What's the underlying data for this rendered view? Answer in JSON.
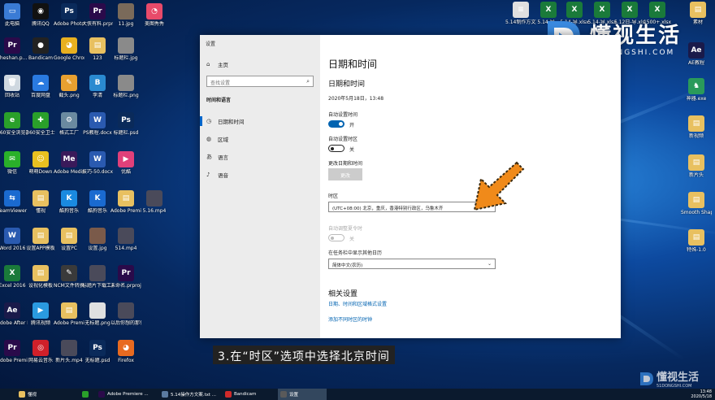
{
  "desktop": {
    "left_icons": [
      {
        "label": "此电脑",
        "color": "#3a7bd5",
        "glyph": "▭"
      },
      {
        "label": "腾讯QQ",
        "color": "#111111",
        "glyph": "◉"
      },
      {
        "label": "Adobe Photosh...",
        "color": "#0a2a5a",
        "glyph": "Ps"
      },
      {
        "label": "大侠有料.prproj",
        "color": "#2a0a4a",
        "glyph": "Pr"
      },
      {
        "label": "11.jpg",
        "color": "#7a6a5a",
        "glyph": ""
      },
      {
        "label": "美图秀秀",
        "color": "#e84a6a",
        "glyph": "◔"
      },
      {
        "label": "zheshan.p...",
        "color": "#2a0a4a",
        "glyph": "Pr"
      },
      {
        "label": "Bandicam",
        "color": "#222222",
        "glyph": "●"
      },
      {
        "label": "Google Chrome",
        "color": "#e8b020",
        "glyph": "◕"
      },
      {
        "label": "123",
        "color": "#e8c060",
        "glyph": "▤"
      },
      {
        "label": "标题栏.jpg",
        "color": "#8a8a8a",
        "glyph": ""
      },
      {
        "label": "回收站",
        "color": "#cfd8e0",
        "glyph": "🗑"
      },
      {
        "label": "百度网盘",
        "color": "#2a7ae0",
        "glyph": "☁"
      },
      {
        "label": "截头.png",
        "color": "#e8a030",
        "glyph": "✎"
      },
      {
        "label": "李清",
        "color": "#2a8ad0",
        "glyph": "B"
      },
      {
        "label": "标题栏.png",
        "color": "#8a8a8a",
        "glyph": ""
      },
      {
        "label": "360安全浏览器",
        "color": "#2aa02a",
        "glyph": "e"
      },
      {
        "label": "360安全卫士",
        "color": "#2aa02a",
        "glyph": "✚"
      },
      {
        "label": "格式工厂",
        "color": "#6a8aa0",
        "glyph": "⚙"
      },
      {
        "label": "PS教程.docx",
        "color": "#2a5ab0",
        "glyph": "W"
      },
      {
        "label": "标题栏.psd",
        "color": "#0a2a5a",
        "glyph": "Ps"
      },
      {
        "label": "微信",
        "color": "#2ab02a",
        "glyph": "✉"
      },
      {
        "label": "萌萌Down",
        "color": "#e8c020",
        "glyph": "☺"
      },
      {
        "label": "Adobe Media...",
        "color": "#3a1a5a",
        "glyph": "Me"
      },
      {
        "label": "技巧-50.docx",
        "color": "#2a5ab0",
        "glyph": "W"
      },
      {
        "label": "优酷",
        "color": "#e0407a",
        "glyph": "▶"
      },
      {
        "label": "TeamViewer",
        "color": "#1a6ad0",
        "glyph": "⇆"
      },
      {
        "label": "懂视",
        "color": "#e8c060",
        "glyph": "▤"
      },
      {
        "label": "酷狗音乐",
        "color": "#1a8ae0",
        "glyph": "K"
      },
      {
        "label": "酷狗音乐",
        "color": "#1a6ad0",
        "glyph": "K"
      },
      {
        "label": "Adobe Premier...",
        "color": "#e8c060",
        "glyph": "▤"
      },
      {
        "label": "5.16.mp4",
        "color": "#4a4a5a",
        "glyph": ""
      },
      {
        "label": "Word 2016",
        "color": "#2a5ab0",
        "glyph": "W"
      },
      {
        "label": "设置APP模板",
        "color": "#e8c060",
        "glyph": "▤"
      },
      {
        "label": "设置PC",
        "color": "#e8c060",
        "glyph": "▤"
      },
      {
        "label": "设置.jpg",
        "color": "#7a5a4a",
        "glyph": ""
      },
      {
        "label": "514.mp4",
        "color": "#4a4a5a",
        "glyph": ""
      },
      {
        "label": "Excel 2016",
        "color": "#1a7a3a",
        "glyph": "X"
      },
      {
        "label": "设视化模板",
        "color": "#e8c060",
        "glyph": "▤"
      },
      {
        "label": "NCM文件转换.exe",
        "color": "#3a3a3a",
        "glyph": "✎"
      },
      {
        "label": "标题片下载工具.mp4",
        "color": "#4a4a5a",
        "glyph": ""
      },
      {
        "label": "未命名.prproj",
        "color": "#2a0a4a",
        "glyph": "Pr"
      },
      {
        "label": "Adobe After Effects 2020",
        "color": "#1a1a4a",
        "glyph": "Ae"
      },
      {
        "label": "腾讯视频",
        "color": "#2a9ae0",
        "glyph": "▶"
      },
      {
        "label": "Adobe Premier...",
        "color": "#e8c060",
        "glyph": "▤"
      },
      {
        "label": "无标题.png",
        "color": "#e0e0e0",
        "glyph": ""
      },
      {
        "label": "以后你想的那件事情.mp4",
        "color": "#4a4a5a",
        "glyph": ""
      },
      {
        "label": "Adobe Premie...",
        "color": "#2a0a4a",
        "glyph": "Pr"
      },
      {
        "label": "网易云音乐",
        "color": "#d0202a",
        "glyph": "◎"
      },
      {
        "label": "新片头.mp4",
        "color": "#4a4a5a",
        "glyph": ""
      },
      {
        "label": "无标题.psd",
        "color": "#0a2a5a",
        "glyph": "Ps"
      },
      {
        "label": "Firefox",
        "color": "#e86a20",
        "glyph": "◕"
      }
    ],
    "top_right_icons": [
      {
        "label": "5.14制作方文案.txt",
        "color": "#e0e0e0",
        "glyph": "≡"
      },
      {
        "label": "5.14-导...",
        "color": "#1a7a3a",
        "glyph": "X"
      },
      {
        "label": "5.14-导.xlsx",
        "color": "#1a7a3a",
        "glyph": "X"
      },
      {
        "label": "5.14-导.xlsx",
        "color": "#1a7a3a",
        "glyph": "X"
      },
      {
        "label": "5.12日-导.xlsx",
        "color": "#1a7a3a",
        "glyph": "X"
      },
      {
        "label": "1500+.xlsx",
        "color": "#1a7a3a",
        "glyph": "X"
      },
      {
        "label": "素材",
        "color": "#e8c060",
        "glyph": "▤"
      }
    ],
    "right_icons": [
      {
        "label": "AE教程",
        "color": "#1a1a4a",
        "glyph": "Ae"
      },
      {
        "label": "神器.exe",
        "color": "#2a9a5a",
        "glyph": "♞"
      },
      {
        "label": "新视频",
        "color": "#e8c060",
        "glyph": "▤"
      },
      {
        "label": "新片头",
        "color": "#e8c060",
        "glyph": "▤"
      },
      {
        "label": "Smooth Shapes...",
        "color": "#e8c060",
        "glyph": "▤"
      },
      {
        "label": "特殊-1.0",
        "color": "#e8c060",
        "glyph": "▤"
      }
    ]
  },
  "window": {
    "title": "设置",
    "sidebar": {
      "home": "主页",
      "search_placeholder": "查找设置",
      "section": "时间和语言",
      "items": [
        {
          "label": "日期和时间",
          "icon": "clock-icon",
          "glyph": "◷"
        },
        {
          "label": "区域",
          "icon": "globe-icon",
          "glyph": "◍"
        },
        {
          "label": "语言",
          "icon": "language-icon",
          "glyph": "あ"
        },
        {
          "label": "语音",
          "icon": "microphone-icon",
          "glyph": "♪"
        }
      ]
    },
    "main": {
      "title": "日期和时间",
      "subtitle": "日期和时间",
      "current_datetime": "2020年5月18日，13:48",
      "auto_time_label": "自动设置时间",
      "auto_time_state": "开",
      "auto_timezone_label": "自动设置时区",
      "auto_timezone_state": "关",
      "change_datetime_label": "更改日期和时间",
      "change_button": "更改",
      "timezone_label": "时区",
      "timezone_value": "(UTC+08:00) 北京，重庆，香港特别行政区，乌鲁木齐",
      "dst_label": "自动调整夏令时",
      "dst_state": "关",
      "calendar_label": "在任务栏中显示其他日历",
      "calendar_value": "简体中文(农历)",
      "related_title": "相关设置",
      "related_link1": "日期、时间和区域格式设置",
      "related_link2": "添加不同时区的时钟"
    }
  },
  "caption": "3.在“时区”选项中选择北京时间",
  "watermark": {
    "brand_cn": "懂视生活",
    "brand_en": "51DONGSHI.COM",
    "small_cn": "懂视生活",
    "small_en": "51DONGSHI.COM"
  },
  "taskbar": {
    "items": [
      {
        "label": "懂视",
        "color": "#e8c060",
        "active": false
      },
      {
        "label": "",
        "color": "#2aa02a",
        "active": false
      },
      {
        "label": "Adobe Premiere ...",
        "color": "#2a0a4a",
        "active": false
      },
      {
        "label": "5.14操作方文案.txt ...",
        "color": "#5a7aa0",
        "active": false
      },
      {
        "label": "Bandicam",
        "color": "#d02a2a",
        "active": false
      },
      {
        "label": "设置",
        "color": "#5a5a5a",
        "active": true
      }
    ],
    "clock_time": "13:48",
    "clock_date": "2020/5/18"
  },
  "colors": {
    "accent": "#0063b1",
    "arrow": "#f08a1a"
  }
}
